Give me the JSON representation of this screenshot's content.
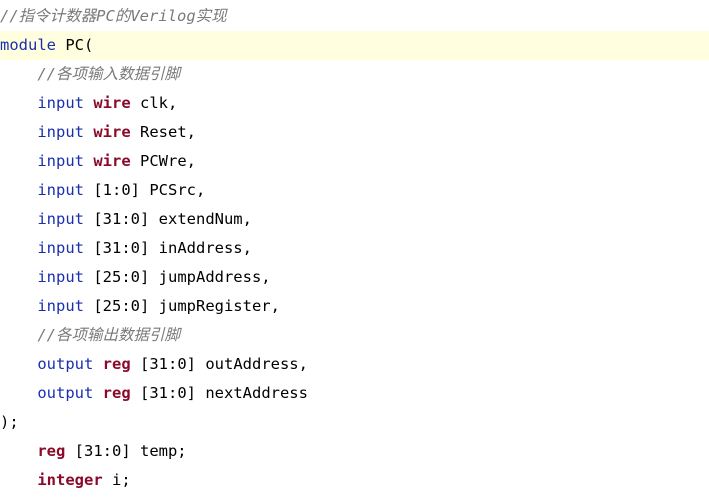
{
  "editor": {
    "colors": {
      "background": "#ffffff",
      "current_line": "#ffffe0",
      "comment": "#7a7a7a",
      "keyword": "#1a2fb0",
      "type": "#8b0a2a",
      "text": "#000000"
    },
    "current_line_index": 1,
    "lines": [
      {
        "tokens": [
          {
            "t": "//指令计数器PC的Verilog实现",
            "k": "comment"
          }
        ]
      },
      {
        "tokens": [
          {
            "t": "module",
            "k": "keyword"
          },
          {
            "t": " PC(",
            "k": "ident"
          }
        ]
      },
      {
        "tokens": [
          {
            "t": "    ",
            "k": "indent"
          },
          {
            "t": "//各项输入数据引脚",
            "k": "comment"
          }
        ]
      },
      {
        "tokens": [
          {
            "t": "    ",
            "k": "indent"
          },
          {
            "t": "input",
            "k": "keyword"
          },
          {
            "t": " ",
            "k": "ident"
          },
          {
            "t": "wire",
            "k": "type"
          },
          {
            "t": " clk,",
            "k": "ident"
          }
        ]
      },
      {
        "tokens": [
          {
            "t": "    ",
            "k": "indent"
          },
          {
            "t": "input",
            "k": "keyword"
          },
          {
            "t": " ",
            "k": "ident"
          },
          {
            "t": "wire",
            "k": "type"
          },
          {
            "t": " Reset,",
            "k": "ident"
          }
        ]
      },
      {
        "tokens": [
          {
            "t": "    ",
            "k": "indent"
          },
          {
            "t": "input",
            "k": "keyword"
          },
          {
            "t": " ",
            "k": "ident"
          },
          {
            "t": "wire",
            "k": "type"
          },
          {
            "t": " PCWre,",
            "k": "ident"
          }
        ]
      },
      {
        "tokens": [
          {
            "t": "    ",
            "k": "indent"
          },
          {
            "t": "input",
            "k": "keyword"
          },
          {
            "t": " [1:0] PCSrc,",
            "k": "ident"
          }
        ]
      },
      {
        "tokens": [
          {
            "t": "    ",
            "k": "indent"
          },
          {
            "t": "input",
            "k": "keyword"
          },
          {
            "t": " [31:0] extendNum,",
            "k": "ident"
          }
        ]
      },
      {
        "tokens": [
          {
            "t": "    ",
            "k": "indent"
          },
          {
            "t": "input",
            "k": "keyword"
          },
          {
            "t": " [31:0] inAddress,",
            "k": "ident"
          }
        ]
      },
      {
        "tokens": [
          {
            "t": "    ",
            "k": "indent"
          },
          {
            "t": "input",
            "k": "keyword"
          },
          {
            "t": " [25:0] jumpAddress,",
            "k": "ident"
          }
        ]
      },
      {
        "tokens": [
          {
            "t": "    ",
            "k": "indent"
          },
          {
            "t": "input",
            "k": "keyword"
          },
          {
            "t": " [25:0] jumpRegister,",
            "k": "ident"
          }
        ]
      },
      {
        "tokens": [
          {
            "t": "    ",
            "k": "indent"
          },
          {
            "t": "//各项输出数据引脚",
            "k": "comment"
          }
        ]
      },
      {
        "tokens": [
          {
            "t": "    ",
            "k": "indent"
          },
          {
            "t": "output",
            "k": "keyword"
          },
          {
            "t": " ",
            "k": "ident"
          },
          {
            "t": "reg",
            "k": "type"
          },
          {
            "t": " [31:0] outAddress,",
            "k": "ident"
          }
        ]
      },
      {
        "tokens": [
          {
            "t": "    ",
            "k": "indent"
          },
          {
            "t": "output",
            "k": "keyword"
          },
          {
            "t": " ",
            "k": "ident"
          },
          {
            "t": "reg",
            "k": "type"
          },
          {
            "t": " [31:0] nextAddress",
            "k": "ident"
          }
        ]
      },
      {
        "tokens": [
          {
            "t": ");",
            "k": "punct"
          }
        ]
      },
      {
        "tokens": [
          {
            "t": "    ",
            "k": "indent"
          },
          {
            "t": "reg",
            "k": "type"
          },
          {
            "t": " [31:0] temp;",
            "k": "ident"
          }
        ]
      },
      {
        "tokens": [
          {
            "t": "    ",
            "k": "indent"
          },
          {
            "t": "integer",
            "k": "type"
          },
          {
            "t": " i;",
            "k": "ident"
          }
        ]
      }
    ]
  }
}
